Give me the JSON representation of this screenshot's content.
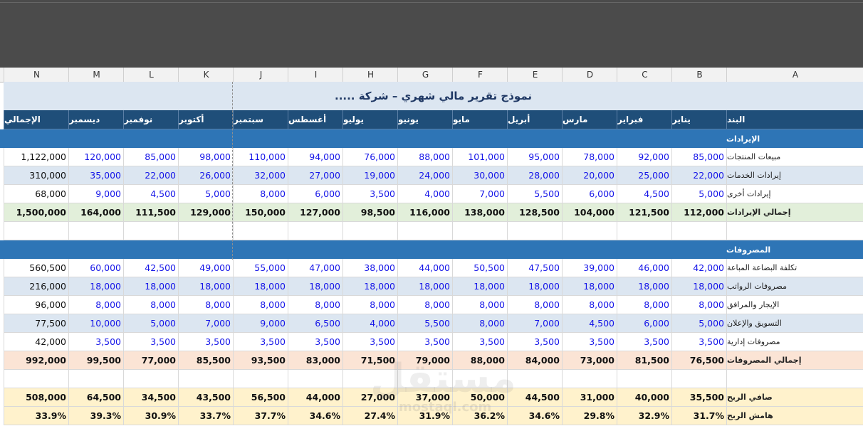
{
  "columns": [
    "N",
    "M",
    "L",
    "K",
    "J",
    "I",
    "H",
    "G",
    "F",
    "E",
    "D",
    "C",
    "B",
    "A"
  ],
  "title": "نموذج تقرير مالي شهري – شركة .....",
  "header": {
    "item": "البند",
    "months": [
      "يناير",
      "فبراير",
      "مارس",
      "أبريل",
      "مايو",
      "يونيو",
      "يوليو",
      "أغسطس",
      "سبتمبر",
      "أكتوبر",
      "نوفمبر",
      "ديسمبر"
    ],
    "total": "الإجمالي"
  },
  "revenue": {
    "section": "الإيرادات",
    "rows": [
      {
        "label": "مبيعات المنتجات",
        "values": [
          "85,000",
          "92,000",
          "78,000",
          "95,000",
          "101,000",
          "88,000",
          "76,000",
          "94,000",
          "110,000",
          "98,000",
          "85,000",
          "120,000"
        ],
        "total": "1,122,000"
      },
      {
        "label": "إيرادات الخدمات",
        "values": [
          "22,000",
          "25,000",
          "20,000",
          "28,000",
          "30,000",
          "24,000",
          "19,000",
          "27,000",
          "32,000",
          "26,000",
          "22,000",
          "35,000"
        ],
        "total": "310,000"
      },
      {
        "label": "إيرادات أخرى",
        "values": [
          "5,000",
          "4,500",
          "6,000",
          "5,500",
          "7,000",
          "4,000",
          "3,500",
          "6,000",
          "8,000",
          "5,000",
          "4,500",
          "9,000"
        ],
        "total": "68,000"
      }
    ],
    "total": {
      "label": "إجمالي الإيرادات",
      "values": [
        "112,000",
        "121,500",
        "104,000",
        "128,500",
        "138,000",
        "116,000",
        "98,500",
        "127,000",
        "150,000",
        "129,000",
        "111,500",
        "164,000"
      ],
      "total": "1,500,000"
    }
  },
  "expenses": {
    "section": "المصروفات",
    "rows": [
      {
        "label": "تكلفة البضاعة المباعة",
        "values": [
          "42,000",
          "46,000",
          "39,000",
          "47,500",
          "50,500",
          "44,000",
          "38,000",
          "47,000",
          "55,000",
          "49,000",
          "42,500",
          "60,000"
        ],
        "total": "560,500"
      },
      {
        "label": "مصروفات الرواتب",
        "values": [
          "18,000",
          "18,000",
          "18,000",
          "18,000",
          "18,000",
          "18,000",
          "18,000",
          "18,000",
          "18,000",
          "18,000",
          "18,000",
          "18,000"
        ],
        "total": "216,000"
      },
      {
        "label": "الإيجار والمرافق",
        "values": [
          "8,000",
          "8,000",
          "8,000",
          "8,000",
          "8,000",
          "8,000",
          "8,000",
          "8,000",
          "8,000",
          "8,000",
          "8,000",
          "8,000"
        ],
        "total": "96,000"
      },
      {
        "label": "التسويق والإعلان",
        "values": [
          "5,000",
          "6,000",
          "4,500",
          "7,000",
          "8,000",
          "5,500",
          "4,000",
          "6,500",
          "9,000",
          "7,000",
          "5,000",
          "10,000"
        ],
        "total": "77,500"
      },
      {
        "label": "مصروفات إدارية",
        "values": [
          "3,500",
          "3,500",
          "3,500",
          "3,500",
          "3,500",
          "3,500",
          "3,500",
          "3,500",
          "3,500",
          "3,500",
          "3,500",
          "3,500"
        ],
        "total": "42,000"
      }
    ],
    "total": {
      "label": "إجمالي المصروفات",
      "values": [
        "76,500",
        "81,500",
        "73,000",
        "84,000",
        "88,000",
        "79,000",
        "71,500",
        "83,000",
        "93,500",
        "85,500",
        "77,000",
        "99,500"
      ],
      "total": "992,000"
    }
  },
  "net_profit": {
    "label": "صافي الربح",
    "values": [
      "35,500",
      "40,000",
      "31,000",
      "44,500",
      "50,000",
      "37,000",
      "27,000",
      "44,000",
      "56,500",
      "43,500",
      "34,500",
      "64,500"
    ],
    "total": "508,000"
  },
  "margin": {
    "label": "هامش الربح",
    "values": [
      "31.7%",
      "32.9%",
      "29.8%",
      "34.6%",
      "36.2%",
      "31.9%",
      "27.4%",
      "34.6%",
      "37.7%",
      "33.7%",
      "30.9%",
      "39.3%"
    ],
    "total": "33.9%"
  },
  "watermark": "مستقل",
  "watermark_small": "mostaql.com"
}
